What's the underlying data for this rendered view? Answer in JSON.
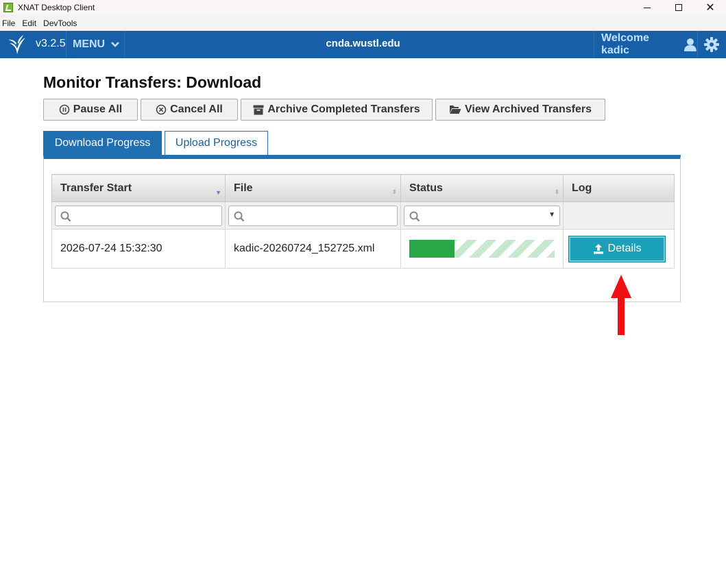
{
  "window": {
    "title": "XNAT Desktop Client",
    "controls": {
      "minimize": "",
      "maximize": "",
      "close": "✕"
    }
  },
  "menubar": [
    "File",
    "Edit",
    "DevTools"
  ],
  "header": {
    "version": "v3.2.5",
    "menu_label": "MENU",
    "host": "cnda.wustl.edu",
    "welcome": "Welcome kadic",
    "colors": {
      "bar": "#1760a8",
      "accent_text": "#bfe0ff"
    },
    "icons": [
      "xnat-logo-icon",
      "chevron-down-icon",
      "user-icon",
      "gear-icon"
    ]
  },
  "page": {
    "title": "Monitor Transfers: Download"
  },
  "toolbar": {
    "pause_all": "Pause All",
    "cancel_all": "Cancel All",
    "archive_completed": "Archive Completed Transfers",
    "view_archived": "View Archived Transfers",
    "icons": [
      "pause-circle-icon",
      "cancel-circle-icon",
      "archive-box-icon",
      "folder-open-icon"
    ]
  },
  "tabs": [
    {
      "label": "Download Progress",
      "active": true
    },
    {
      "label": "Upload Progress",
      "active": false
    }
  ],
  "table": {
    "columns": [
      "Transfer Start",
      "File",
      "Status",
      "Log"
    ],
    "status_filter_selected": "",
    "rows": [
      {
        "transfer_start": "2026-07-24 15:32:30",
        "file": "kadic-20260724_152725.xml",
        "progress_fraction": 0.31,
        "log_button": "Details"
      }
    ],
    "colors": {
      "progress_fill": "#27a844",
      "details_button": "#1aa1b8"
    }
  },
  "annotation": {
    "icon": "up-arrow-icon",
    "color": "#ee1111"
  }
}
